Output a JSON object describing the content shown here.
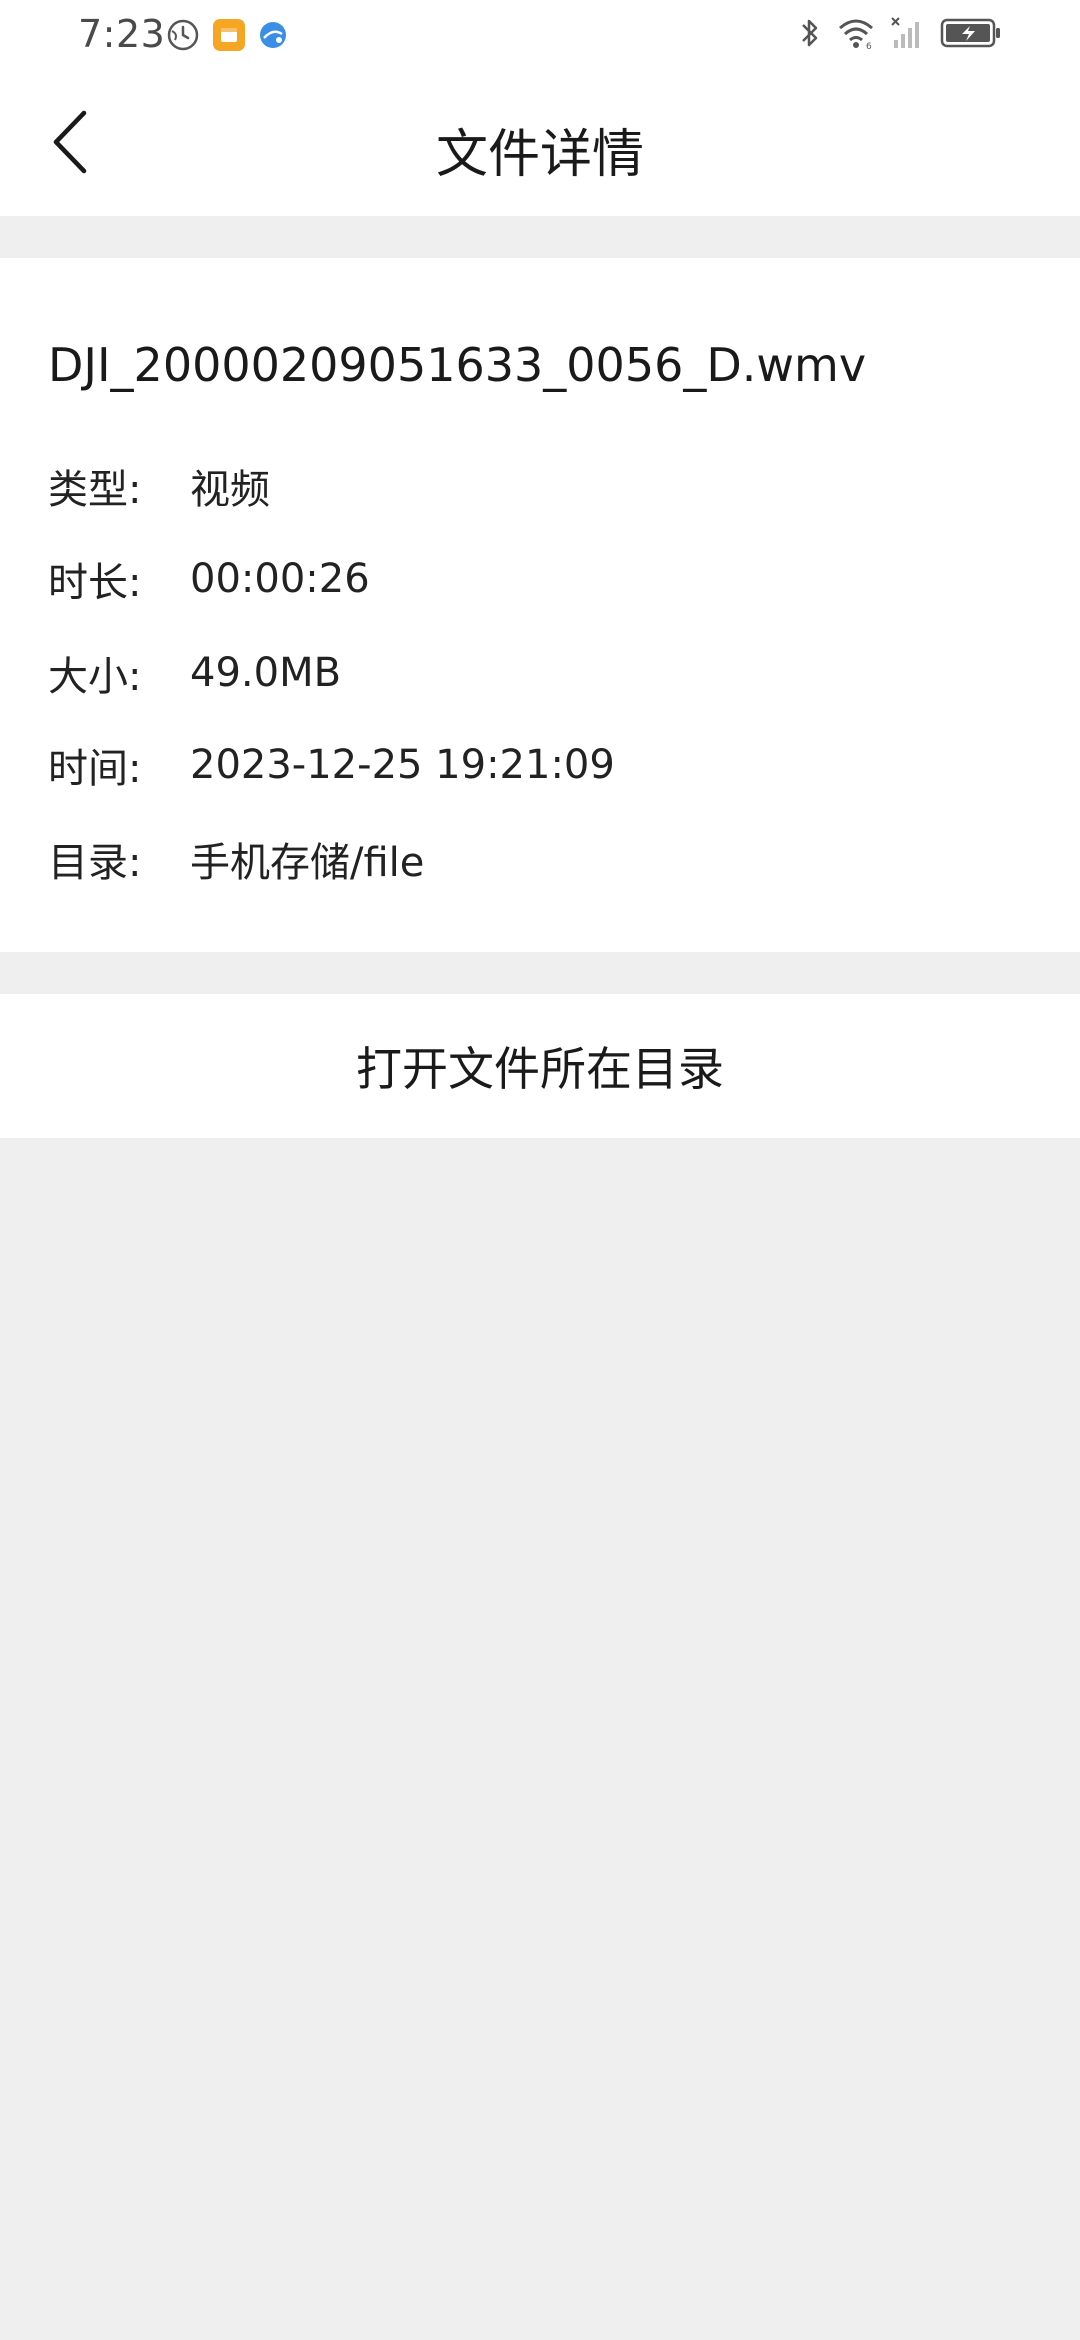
{
  "status_bar": {
    "time": "7:23",
    "icons_left": [
      "globe-clock-icon",
      "app-notification-icon",
      "browser-icon"
    ],
    "icons_right": [
      "bluetooth-icon",
      "wifi-icon",
      "no-sim-signal-icon",
      "battery-charging-icon"
    ],
    "accent_orange": "#f5a623",
    "accent_blue": "#3a8ee6"
  },
  "app_bar": {
    "title": "文件详情",
    "back_icon": "chevron-left-icon"
  },
  "file": {
    "name": "DJI_20000209051633_0056_D.wmv",
    "details": [
      {
        "label": "类型:",
        "value": "视频"
      },
      {
        "label": "时长:",
        "value": "00:00:26"
      },
      {
        "label": "大小:",
        "value": "49.0MB"
      },
      {
        "label": "时间:",
        "value": "2023-12-25 19:21:09"
      },
      {
        "label": "目录:",
        "value": "手机存储/file"
      }
    ]
  },
  "actions": {
    "open_directory_label": "打开文件所在目录"
  }
}
